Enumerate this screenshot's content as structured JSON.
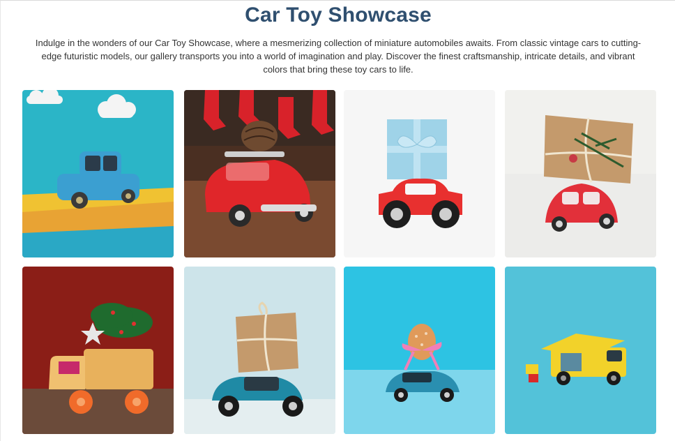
{
  "header": {
    "title": "Car Toy Showcase",
    "intro": "Indulge in the wonders of our Car Toy Showcase, where a mesmerizing collection of miniature automobiles awaits. From classic vintage cars to cutting-edge futuristic models, our gallery transports you into a world of imagination and play. Discover the finest craftsmanship, intricate details, and vibrant colors that bring these toy cars to life."
  },
  "gallery": {
    "items": [
      {
        "name": "blue-toy-car-cloud-scene",
        "icon": "blue-car-photo",
        "bg": "#2bb7c9",
        "car": "#3a9fd0"
      },
      {
        "name": "red-car-pinecone-stockings",
        "icon": "red-car-photo",
        "bg": "#5a3a2a",
        "car": "#e0262a"
      },
      {
        "name": "red-car-blue-gift",
        "icon": "gift-car-photo",
        "bg": "#f6f6f6",
        "car": "#e8302f"
      },
      {
        "name": "red-beetle-kraft-gift",
        "icon": "gift-beetle-photo",
        "bg": "#f1f1ee",
        "car": "#e2303a"
      },
      {
        "name": "wooden-truck-christmas-tree",
        "icon": "truck-tree-photo",
        "bg": "#8b1e17",
        "car": "#e8b15c"
      },
      {
        "name": "teal-car-kraft-parcel",
        "icon": "parcel-car-photo",
        "bg": "#cde4ea",
        "car": "#1f8aa5"
      },
      {
        "name": "teal-car-easter-egg",
        "icon": "egg-car-photo",
        "bg": "#2dc3e3",
        "car": "#2a8fb0"
      },
      {
        "name": "yellow-van-blocks",
        "icon": "van-photo",
        "bg": "#53c2d9",
        "car": "#f2d22a"
      }
    ]
  }
}
